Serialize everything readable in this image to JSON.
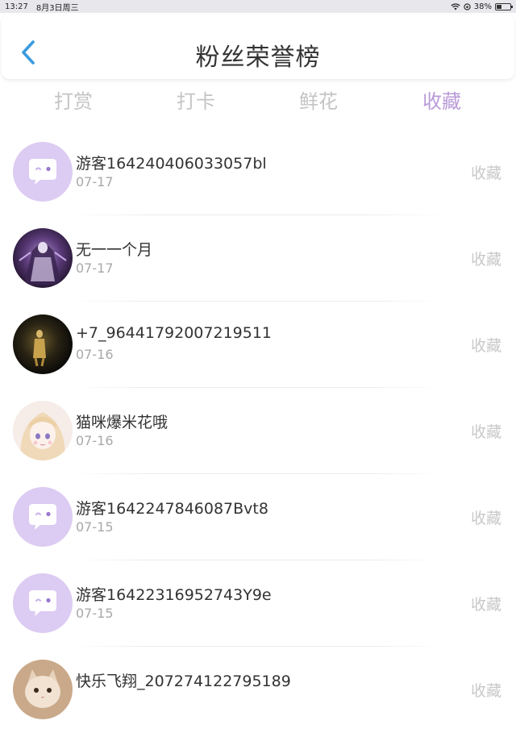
{
  "status_bar": {
    "time": "13:27",
    "date": "8月3日周三",
    "battery": "38%",
    "battery_level": 0.38
  },
  "header": {
    "title": "粉丝荣誉榜",
    "back_icon": "chevron-left-icon"
  },
  "tabs": [
    {
      "label": "打赏",
      "active": false
    },
    {
      "label": "打卡",
      "active": false
    },
    {
      "label": "鲜花",
      "active": false
    },
    {
      "label": "收藏",
      "active": true
    }
  ],
  "fans": [
    {
      "name": "游客164240406033057bl",
      "date": "07-17",
      "action": "收藏",
      "avatar": "default-chat-avatar"
    },
    {
      "name": "无一一个月",
      "date": "07-17",
      "action": "收藏",
      "avatar": "dark-purple-character-avatar"
    },
    {
      "name": "+7_96441792007219511",
      "date": "07-16",
      "action": "收藏",
      "avatar": "dark-golden-figure-avatar"
    },
    {
      "name": "猫咪爆米花哦",
      "date": "07-16",
      "action": "收藏",
      "avatar": "anime-girl-avatar"
    },
    {
      "name": "游客1642247846087Bvt8",
      "date": "07-15",
      "action": "收藏",
      "avatar": "default-chat-avatar"
    },
    {
      "name": "游客16422316952743Y9e",
      "date": "07-15",
      "action": "收藏",
      "avatar": "default-chat-avatar"
    },
    {
      "name": "快乐飞翔_207274122795189",
      "date": "",
      "action": "收藏",
      "avatar": "cat-photo-avatar"
    }
  ],
  "colors": {
    "accent": "#b99ad8",
    "back_arrow": "#3a9be0",
    "default_avatar_bg": "#dccbf2"
  }
}
